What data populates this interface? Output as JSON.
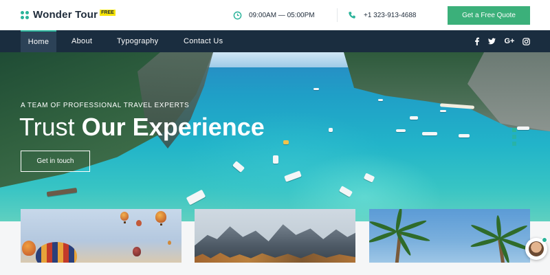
{
  "brand": {
    "name": "Wonder Tour",
    "badge": "FREE",
    "accent": "#2bb39a"
  },
  "header": {
    "hours": "09:00AM — 05:00PM",
    "phone": "+1 323-913-4688",
    "cta_label": "Get a Free Quote",
    "hours_icon": "clock-icon",
    "phone_icon": "phone-icon"
  },
  "nav": {
    "items": [
      {
        "label": "Home"
      },
      {
        "label": "About"
      },
      {
        "label": "Typography"
      },
      {
        "label": "Contact Us"
      }
    ],
    "social": [
      {
        "icon": "facebook-icon",
        "glyph": "f"
      },
      {
        "icon": "twitter-icon",
        "glyph": "🐦"
      },
      {
        "icon": "google-plus-icon",
        "glyph": "G+"
      },
      {
        "icon": "instagram-icon",
        "glyph": "◎"
      }
    ]
  },
  "hero": {
    "subtitle": "A TEAM OF PROFESSIONAL TRAVEL EXPERTS",
    "title_light": "Trust ",
    "title_bold": "Our Experience",
    "button_label": "Get in touch",
    "slides": 3,
    "active_slide": 1
  },
  "cards": [
    {
      "image": "hot-air-balloons"
    },
    {
      "image": "mountain-range"
    },
    {
      "image": "palm-trees"
    }
  ],
  "colors": {
    "nav_bg": "#1a2d3f",
    "cta_bg": "#3bb07a",
    "text_dark": "#1e2b3a"
  }
}
